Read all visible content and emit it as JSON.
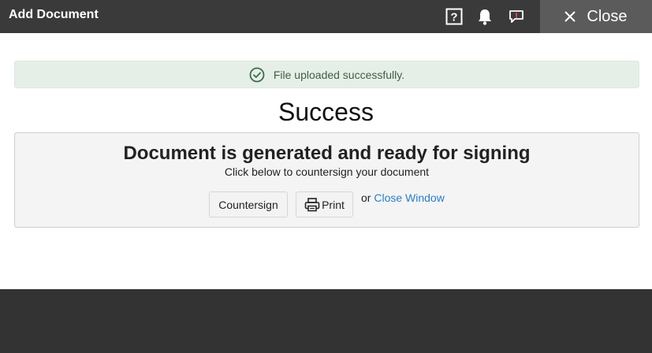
{
  "header": {
    "title": "Add Document",
    "close_label": "Close"
  },
  "alert": {
    "message": "File uploaded successfully."
  },
  "main": {
    "heading": "Success",
    "panel_title": "Document is generated and ready for signing",
    "panel_subtitle": "Click below to countersign your document",
    "countersign_label": "Countersign",
    "print_label": "Print",
    "or_text": "or",
    "close_window_label": "Close Window"
  },
  "icons": {
    "help": "help-icon",
    "notifications": "bell-icon",
    "chat": "chat-icon",
    "close": "close-icon",
    "success": "check-circle-icon",
    "print": "printer-icon"
  },
  "colors": {
    "topbar": "#3a3a3a",
    "close_button": "#5b5b5b",
    "alert_background": "#e6efe7",
    "alert_text": "#3f5f47",
    "link": "#2a7dc8"
  }
}
